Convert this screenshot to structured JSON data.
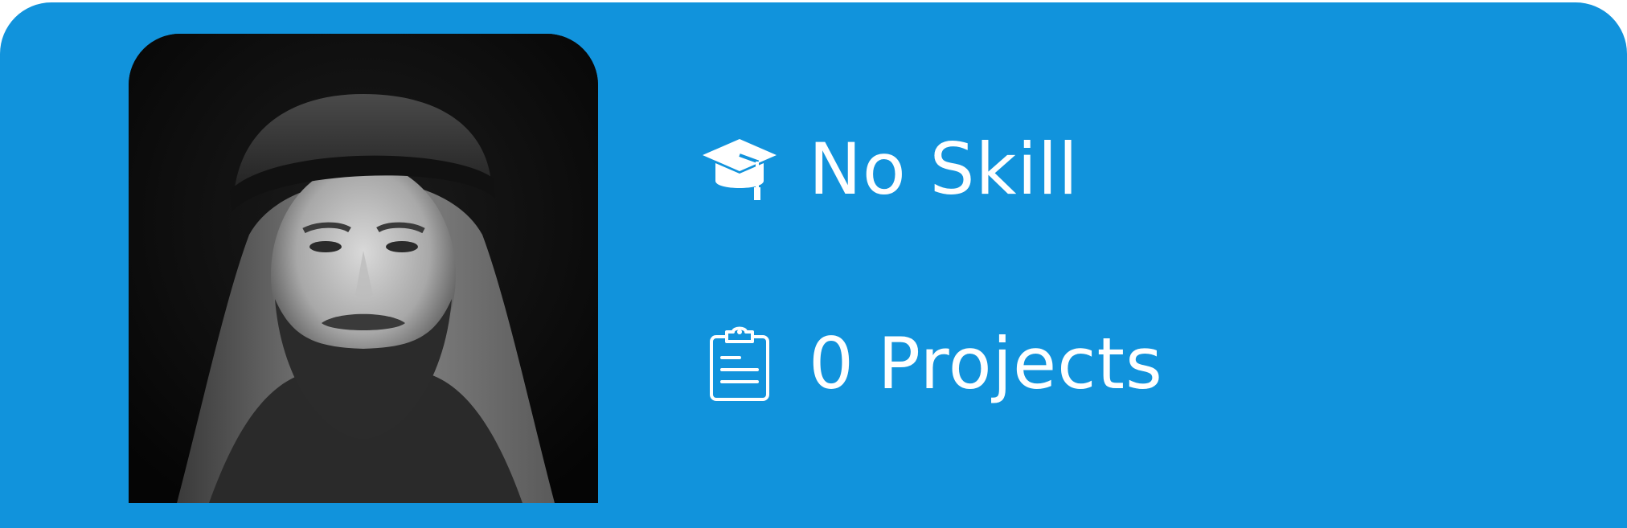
{
  "profile": {
    "avatar_alt": "Profile photo",
    "skill": {
      "icon": "graduation-cap-icon",
      "label": "No Skill"
    },
    "projects": {
      "icon": "clipboard-icon",
      "label": "0 Projects"
    }
  },
  "colors": {
    "card_background": "#1193dc",
    "text": "#ffffff",
    "photo_background": "#0b0b0b"
  }
}
